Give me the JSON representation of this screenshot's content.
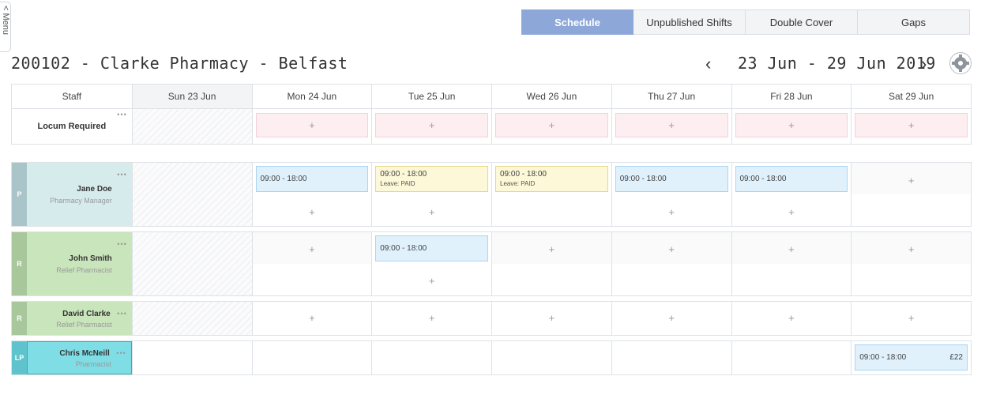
{
  "menu": {
    "label": "< Menu"
  },
  "tabs": [
    {
      "label": "Schedule",
      "active": true
    },
    {
      "label": "Unpublished Shifts",
      "active": false
    },
    {
      "label": "Double Cover",
      "active": false
    },
    {
      "label": "Gaps",
      "active": false
    }
  ],
  "header": {
    "title": "200102 - Clarke Pharmacy - Belfast",
    "prev_icon": "‹",
    "week_range": "23 Jun - 29 Jun 2019",
    "next_icon": "›",
    "settings_icon": "gear-icon"
  },
  "grid": {
    "staff_header": "Staff",
    "days": [
      "Sun 23 Jun",
      "Mon 24 Jun",
      "Tue 25 Jun",
      "Wed 26 Jun",
      "Thu 27 Jun",
      "Fri 28 Jun",
      "Sat 29 Jun"
    ],
    "add_symbol": "+",
    "more_symbol": "•••",
    "locum": {
      "label": "Locum Required"
    }
  },
  "staff": [
    {
      "badge": "P",
      "badge_color": "#a9c5c9",
      "panel_color": "#d6ebec",
      "name": "Jane Doe",
      "role": "Pharmacy Manager",
      "shifts": {
        "mon": {
          "time": "09:00 - 18:00"
        },
        "tue": {
          "time": "09:00 - 18:00",
          "note": "Leave: PAID"
        },
        "wed": {
          "time": "09:00 - 18:00",
          "note": "Leave: PAID"
        },
        "thu": {
          "time": "09:00 - 18:00"
        },
        "fri": {
          "time": "09:00 - 18:00"
        }
      }
    },
    {
      "badge": "R",
      "badge_color": "#a8c79b",
      "panel_color": "#c9e5bb",
      "name": "John Smith",
      "role": "Relief Pharmacist",
      "shifts": {
        "tue": {
          "time": "09:00 - 18:00"
        }
      }
    },
    {
      "badge": "R",
      "badge_color": "#a8c79b",
      "panel_color": "#c9e5bb",
      "name": "David Clarke",
      "role": "Relief Pharmacist"
    },
    {
      "badge": "LP",
      "badge_color": "#5ec3cc",
      "panel_color": "#7fdde6",
      "name": "Chris McNeill",
      "role": "Pharmacist",
      "shifts": {
        "sat": {
          "time": "09:00 - 18:00",
          "price": "£22"
        }
      }
    }
  ],
  "colors": {
    "accent": "#8da7d9",
    "shift_blue": "#e0f1fc",
    "leave_yellow": "#fdf8d8",
    "locum_pink": "#fdeef2"
  }
}
